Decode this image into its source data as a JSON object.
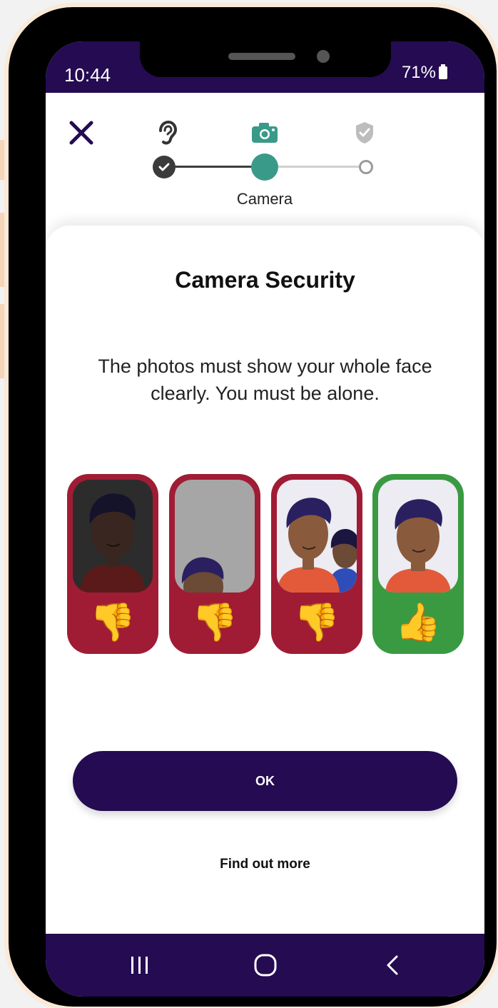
{
  "status_bar": {
    "time": "10:44",
    "battery": "71%"
  },
  "steps": {
    "items": [
      {
        "icon": "ear-icon",
        "state": "done"
      },
      {
        "icon": "camera-icon",
        "state": "current"
      },
      {
        "icon": "shield-check-icon",
        "state": "pending"
      }
    ],
    "current_label": "Camera"
  },
  "content": {
    "title": "Camera Security",
    "description": "The photos must show your whole face clearly. You must be alone."
  },
  "examples": [
    {
      "verdict": "thumbs-down",
      "issue": "dark",
      "frame_color": "#a01c34"
    },
    {
      "verdict": "thumbs-down",
      "issue": "partial-face",
      "frame_color": "#a01c34"
    },
    {
      "verdict": "thumbs-down",
      "issue": "not-alone",
      "frame_color": "#a01c34"
    },
    {
      "verdict": "thumbs-up",
      "issue": "none",
      "frame_color": "#3a9a42"
    }
  ],
  "actions": {
    "ok_label": "OK",
    "find_out_more_label": "Find out more"
  },
  "colors": {
    "brand": "#240b52",
    "accent": "#3a9a8a",
    "bad": "#a01c34",
    "good": "#3a9a42"
  }
}
